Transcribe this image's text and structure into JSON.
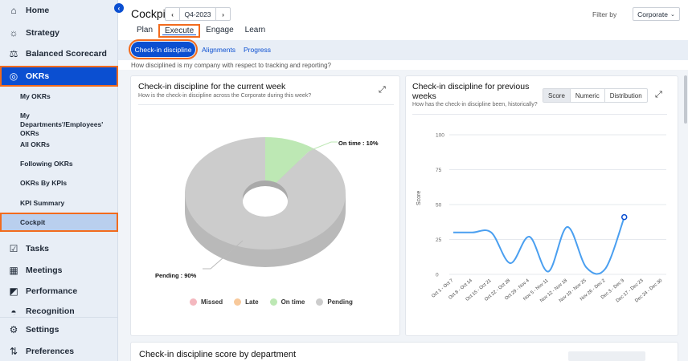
{
  "sidebar": {
    "items": [
      {
        "label": "Home",
        "icon": "home-icon"
      },
      {
        "label": "Strategy",
        "icon": "bulb-icon"
      },
      {
        "label": "Balanced Scorecard",
        "icon": "balance-icon"
      },
      {
        "label": "OKRs",
        "icon": "target-icon"
      },
      {
        "label": "Tasks",
        "icon": "tasks-icon"
      },
      {
        "label": "Meetings",
        "icon": "calendar-icon"
      },
      {
        "label": "Performance",
        "icon": "performance-icon"
      },
      {
        "label": "Recognition",
        "icon": "recognition-icon"
      },
      {
        "label": "Settings",
        "icon": "settings-icon"
      },
      {
        "label": "Preferences",
        "icon": "preferences-icon"
      }
    ],
    "okr_sub": [
      "My OKRs",
      "My Departments'/Employees' OKRs",
      "All OKRs",
      "Following OKRs",
      "OKRs By KPIs",
      "KPI Summary",
      "Cockpit"
    ]
  },
  "header": {
    "title": "Cockpit",
    "quarter": "Q4-2023",
    "filter_label": "Filter by",
    "filter_value": "Corporate"
  },
  "tabs": [
    "Plan",
    "Execute",
    "Engage",
    "Learn"
  ],
  "subtabs": [
    "Check-in discipline",
    "Alignments",
    "Progress"
  ],
  "question": "How disciplined is my company with respect to tracking and reporting?",
  "card_current": {
    "title": "Check-in discipline for the current week",
    "subtitle": "How is the check-in discipline across the Corporate during this week?",
    "on_time_label": "On time : 10%",
    "pending_label": "Pending : 90%",
    "legend": [
      {
        "label": "Missed",
        "color": "#f4b8bf"
      },
      {
        "label": "Late",
        "color": "#f8c99b"
      },
      {
        "label": "On time",
        "color": "#bde8b4"
      },
      {
        "label": "Pending",
        "color": "#cccccc"
      }
    ]
  },
  "card_previous": {
    "title_line1": "Check-in discipline for previous",
    "title_line2": "weeks",
    "subtitle": "How has the check-in discipline been, historically?",
    "segments": [
      "Score",
      "Numeric",
      "Distribution"
    ],
    "ylabel": "Score"
  },
  "bottom_title": "Check-in discipline score by department",
  "chart_data": [
    {
      "type": "pie",
      "title": "Check-in discipline for the current week",
      "categories": [
        "Missed",
        "Late",
        "On time",
        "Pending"
      ],
      "values": [
        0,
        0,
        10,
        90
      ],
      "colors": [
        "#f4b8bf",
        "#f8c99b",
        "#bde8b4",
        "#cccccc"
      ]
    },
    {
      "type": "line",
      "title": "Check-in discipline for previous weeks",
      "ylabel": "Score",
      "ylim": [
        0,
        100
      ],
      "yticks": [
        0,
        25,
        50,
        75,
        100
      ],
      "categories": [
        "Oct 1 - Oct 7",
        "Oct 8 - Oct 14",
        "Oct 15 - Oct 21",
        "Oct 22 - Oct 28",
        "Oct 29 - Nov 4",
        "Nov 5 - Nov 11",
        "Nov 12 - Nov 18",
        "Nov 19 - Nov 25",
        "Nov 26 - Dec 2",
        "Dec 3 - Dec 9",
        "Dec 17 - Dec 23",
        "Dec 24 - Dec 30"
      ],
      "values": [
        30,
        30,
        30,
        8,
        27,
        2,
        34,
        5,
        4,
        41,
        null,
        null
      ],
      "color": "#4a9ff0"
    }
  ]
}
